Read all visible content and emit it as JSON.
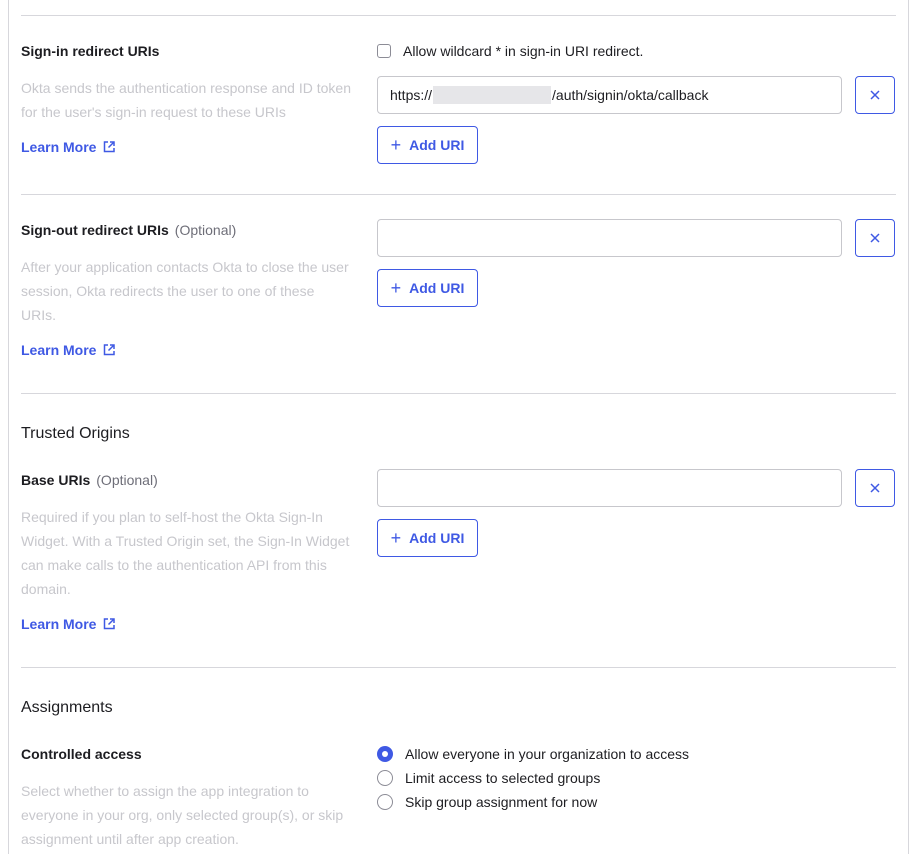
{
  "signin": {
    "label": "Sign-in redirect URIs",
    "description": "Okta sends the authentication response and ID token for the user's sign-in request to these URIs",
    "learn_more": "Learn More",
    "wildcard_label": "Allow wildcard * in sign-in URI redirect.",
    "wildcard_checked": false,
    "uri_prefix": "https://",
    "uri_suffix": "/auth/signin/okta/callback",
    "add_uri": "Add URI"
  },
  "signout": {
    "label": "Sign-out redirect URIs",
    "optional": "(Optional)",
    "description": "After your application contacts Okta to close the user session, Okta redirects the user to one of these URIs.",
    "learn_more": "Learn More",
    "uri_value": "",
    "add_uri": "Add URI"
  },
  "trusted_origins": {
    "heading": "Trusted Origins",
    "label": "Base URIs",
    "optional": "(Optional)",
    "description": "Required if you plan to self-host the Okta Sign-In Widget. With a Trusted Origin set, the Sign-In Widget can make calls to the authentication API from this domain.",
    "learn_more": "Learn More",
    "uri_value": "",
    "add_uri": "Add URI"
  },
  "assignments": {
    "heading": "Assignments",
    "label": "Controlled access",
    "description": "Select whether to assign the app integration to everyone in your org, only selected group(s), or skip assignment until after app creation.",
    "options": [
      {
        "label": "Allow everyone in your organization to access",
        "selected": true
      },
      {
        "label": "Limit access to selected groups",
        "selected": false
      },
      {
        "label": "Skip group assignment for now",
        "selected": false
      }
    ]
  },
  "colors": {
    "accent": "#3f59e4",
    "muted_text": "#c7c7cc",
    "border": "#d7d7dc"
  },
  "icons": {
    "external_link": "external-link-icon",
    "remove": "close-icon",
    "add": "plus-icon"
  }
}
